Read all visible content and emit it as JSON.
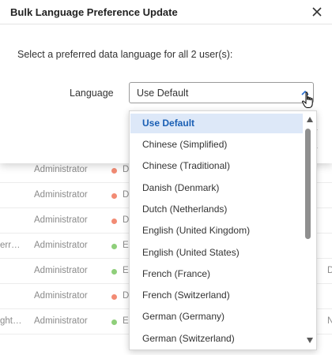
{
  "dialog": {
    "title": "Bulk Language Preference Update",
    "instruction": "Select a preferred data language for all 2 user(s):",
    "language_label": "Language",
    "selected_value": "Use Default"
  },
  "dropdown": {
    "options": [
      "Use Default",
      "Chinese (Simplified)",
      "Chinese (Traditional)",
      "Danish (Denmark)",
      "Dutch (Netherlands)",
      "English (United Kingdom)",
      "English (United States)",
      "French (France)",
      "French (Switzerland)",
      "German (Germany)",
      "German (Switzerland)"
    ],
    "highlighted_index": 0
  },
  "table": {
    "rows": [
      {
        "name": "",
        "role": "Administrator",
        "status_color": "#f28b74",
        "status_letter": "D",
        "extra": ""
      },
      {
        "name": "",
        "role": "Administrator",
        "status_color": "#f28b74",
        "status_letter": "D",
        "extra": ""
      },
      {
        "name": "",
        "role": "Administrator",
        "status_color": "#f28b74",
        "status_letter": "D",
        "extra": ""
      },
      {
        "name": "err…",
        "role": "Administrator",
        "status_color": "#8fcf7a",
        "status_letter": "E",
        "extra": ""
      },
      {
        "name": "",
        "role": "Administrator",
        "status_color": "#8fcf7a",
        "status_letter": "E",
        "extra": "D"
      },
      {
        "name": "",
        "role": "Administrator",
        "status_color": "#f28b74",
        "status_letter": "D",
        "extra": ""
      },
      {
        "name": "ght…",
        "role": "Administrator",
        "status_color": "#8fcf7a",
        "status_letter": "E",
        "extra": "N"
      }
    ]
  },
  "icons": {
    "close": "close-icon",
    "chevron": "chevron-up-icon",
    "cursor": "hand-pointer-icon",
    "scroll_up": "triangle-up-icon",
    "scroll_down": "triangle-down-icon"
  },
  "colors": {
    "accent": "#1a5fb4",
    "selected_bg": "#dde8f8",
    "status_inactive": "#f28b74",
    "status_active": "#8fcf7a"
  }
}
